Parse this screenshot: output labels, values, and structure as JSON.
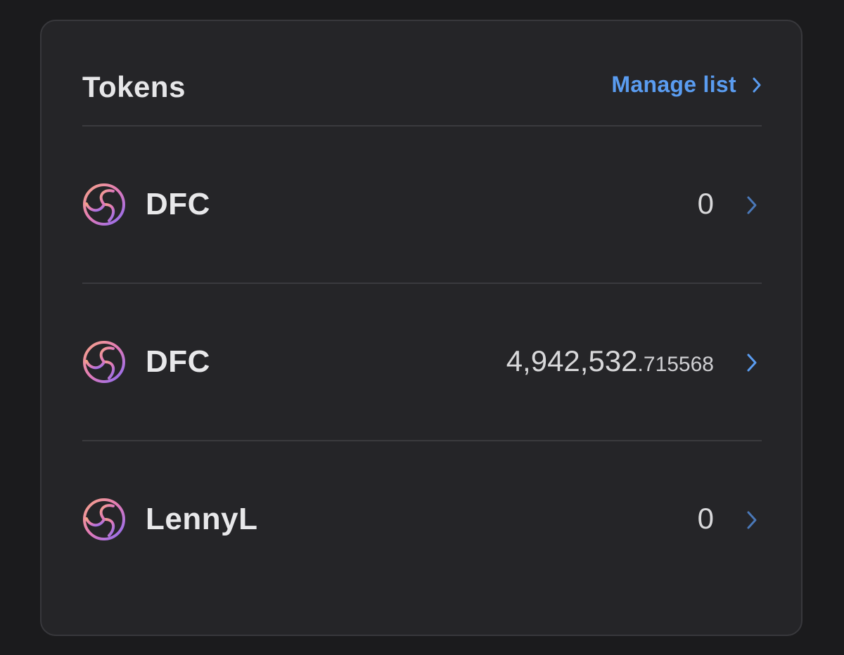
{
  "header": {
    "title": "Tokens",
    "manage_label": "Manage list"
  },
  "tokens": [
    {
      "name": "DFC",
      "amount_int": "0",
      "amount_dec": "",
      "chevron_color": "#4a78b8"
    },
    {
      "name": "DFC",
      "amount_int": "4,942,532",
      "amount_dec": ".715568",
      "chevron_color": "#5a9cf0"
    },
    {
      "name": "LennyL",
      "amount_int": "0",
      "amount_dec": "",
      "chevron_color": "#4a78b8"
    }
  ],
  "icons": {
    "token": "token-logo-icon",
    "chevron": "chevron-right-icon"
  },
  "colors": {
    "background": "#1b1b1d",
    "card": "#252528",
    "accent": "#5a9cf0"
  }
}
